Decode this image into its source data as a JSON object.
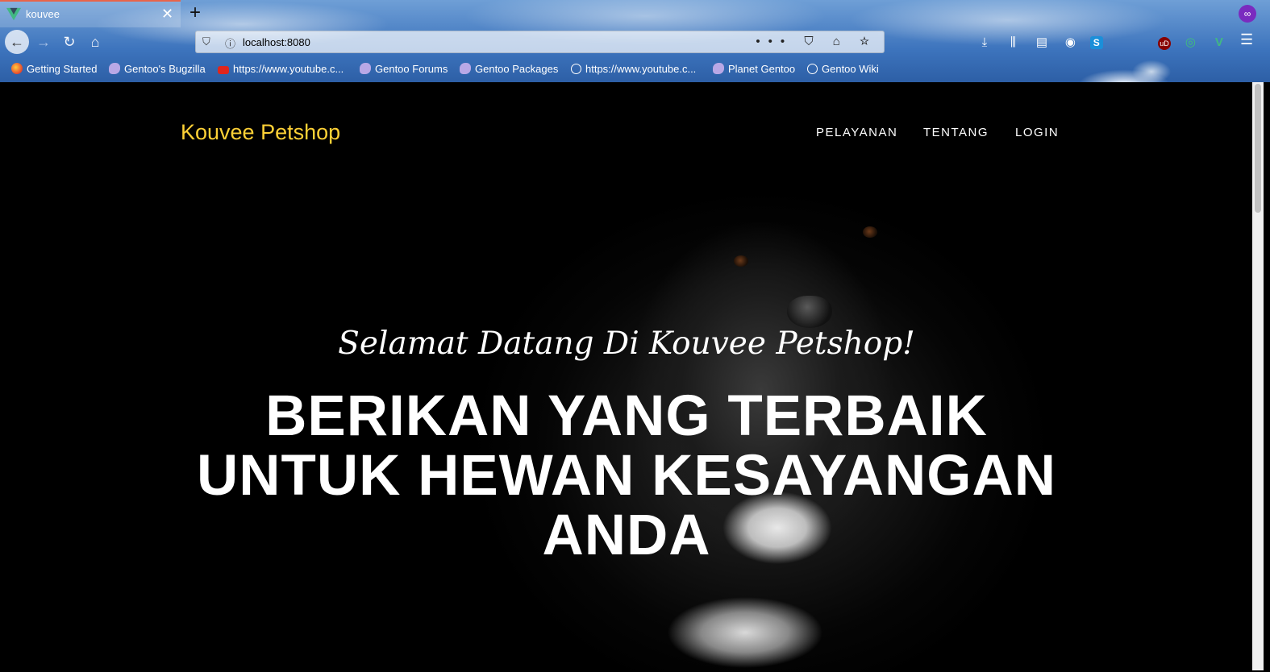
{
  "browser": {
    "tab_title": "kouvee",
    "tab_close": "✕",
    "new_tab": "+",
    "url": "localhost:8080",
    "url_actions": "•••  ⛉  ⌂  ☆",
    "bookmarks": [
      {
        "label": "Getting Started",
        "icon": "firefox-icon"
      },
      {
        "label": "Gentoo's Bugzilla",
        "icon": "gentoo-icon"
      },
      {
        "label": "https://www.youtube.c...",
        "icon": "youtube-icon"
      },
      {
        "label": "Gentoo Forums",
        "icon": "gentoo-icon"
      },
      {
        "label": "Gentoo Packages",
        "icon": "gentoo-icon"
      },
      {
        "label": "https://www.youtube.c...",
        "icon": "globe-icon"
      },
      {
        "label": "Planet Gentoo",
        "icon": "gentoo-icon"
      },
      {
        "label": "Gentoo Wiki",
        "icon": "globe-icon"
      }
    ],
    "toolbar_icons": [
      "download-icon",
      "library-icon",
      "sidebar-icon",
      "account-icon",
      "extension-s-icon",
      "extension-ublock-icon",
      "extension-sync-icon",
      "extension-vue-icon"
    ],
    "colors": {
      "tab_accent": "#e8644a",
      "private_badge": "#7a2bbf"
    }
  },
  "page": {
    "brand": "Kouvee Petshop",
    "nav": {
      "pelayanan": "PELAYANAN",
      "tentang": "TENTANG",
      "login": "LOGIN"
    },
    "hero": {
      "lead_in": "Selamat Datang Di Kouvee Petshop!",
      "heading_line1": "BERIKAN YANG TERBAIK",
      "heading_line2": "UNTUK HEWAN KESAYANGAN",
      "heading_line3": "ANDA"
    },
    "colors": {
      "brand": "#fed136",
      "background": "#000000",
      "text": "#ffffff"
    }
  }
}
